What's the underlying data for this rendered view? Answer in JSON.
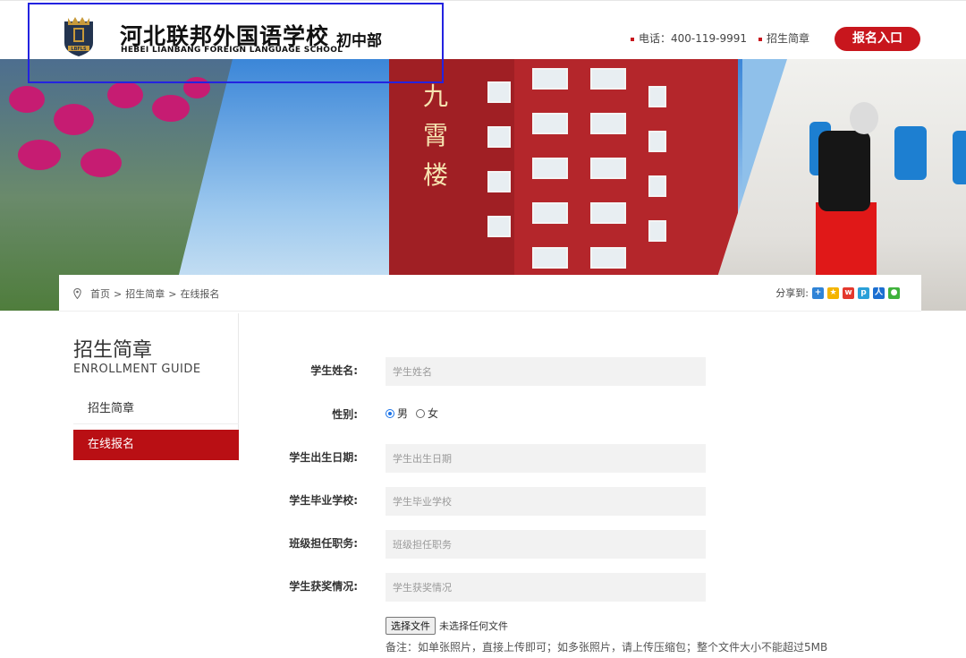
{
  "header": {
    "school_name_cn": "河北联邦外国语学校",
    "school_name_en": "HEBEI LIANBANG FOREIGN LANGUAGE SCHOOL",
    "division": "初中部",
    "crest_text": "LBFLS",
    "phone": "电话：400-119-9991",
    "guide_link": "招生简章",
    "enroll_button": "报名入口"
  },
  "banner": {
    "tower_name": "九霄楼"
  },
  "breadcrumb": {
    "home": "首页",
    "sep": ">",
    "guide": "招生简章",
    "current": "在线报名"
  },
  "share": {
    "label": "分享到:"
  },
  "sidebar": {
    "title": "招生简章",
    "subtitle": "ENROLLMENT GUIDE",
    "items": [
      {
        "label": "招生简章"
      },
      {
        "label": "在线报名"
      }
    ]
  },
  "form": {
    "name": {
      "label": "学生姓名:",
      "placeholder": "学生姓名"
    },
    "gender": {
      "label": "性别:",
      "options": [
        "男",
        "女"
      ],
      "selected": "男"
    },
    "birth": {
      "label": "学生出生日期:",
      "placeholder": "学生出生日期"
    },
    "school": {
      "label": "学生毕业学校:",
      "placeholder": "学生毕业学校"
    },
    "class_role": {
      "label": "班级担任职务:",
      "placeholder": "班级担任职务"
    },
    "awards": {
      "label": "学生获奖情况:",
      "placeholder": "学生获奖情况"
    },
    "file": {
      "button": "选择文件",
      "status": "未选择任何文件"
    },
    "note": "备注：如单张照片，直接上传即可；如多张照片，请上传压缩包；整个文件大小不能超过5MB"
  },
  "colors": {
    "accent": "#c8161d",
    "sidebar_active": "#b90f14",
    "highlight_box": "#2323e0"
  }
}
